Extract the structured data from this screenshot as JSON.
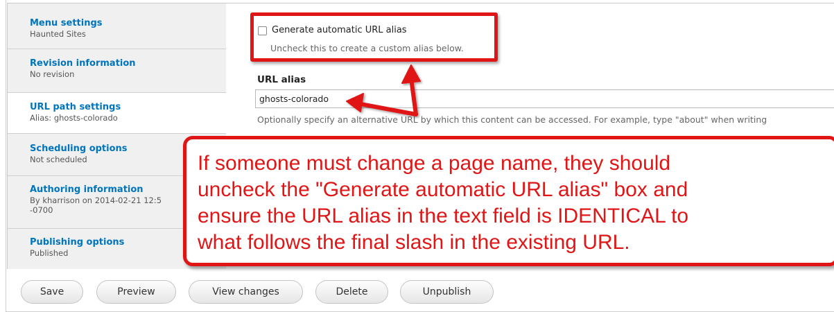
{
  "vertical_tabs": [
    {
      "title": "Menu settings",
      "summary": "Haunted Sites"
    },
    {
      "title": "Revision information",
      "summary": "No revision"
    },
    {
      "title": "URL path settings",
      "summary": "Alias: ghosts-colorado"
    },
    {
      "title": "Scheduling options",
      "summary": "Not scheduled"
    },
    {
      "title": "Authoring information",
      "summary": "By kharrison on 2014-02-21 12:5",
      "summary2": "-0700"
    },
    {
      "title": "Publishing options",
      "summary": "Published"
    }
  ],
  "url_settings": {
    "checkbox_label": "Generate automatic URL alias",
    "checkbox_checked": false,
    "checkbox_description": "Uncheck this to create a custom alias below.",
    "alias_label": "URL alias",
    "alias_value": "ghosts-colorado",
    "alias_help": "Optionally specify an alternative URL by which this content can be accessed. For example, type \"about\" when writing"
  },
  "annotation": {
    "lines": [
      "If someone must change a page name, they should",
      "uncheck the \"Generate automatic URL alias\" box and",
      "ensure the URL alias in the text field is IDENTICAL to",
      "what follows the final slash in the existing URL."
    ],
    "color": "#e01515"
  },
  "actions": {
    "save": "Save",
    "preview": "Preview",
    "view_changes": "View changes",
    "delete": "Delete",
    "unpublish": "Unpublish"
  }
}
